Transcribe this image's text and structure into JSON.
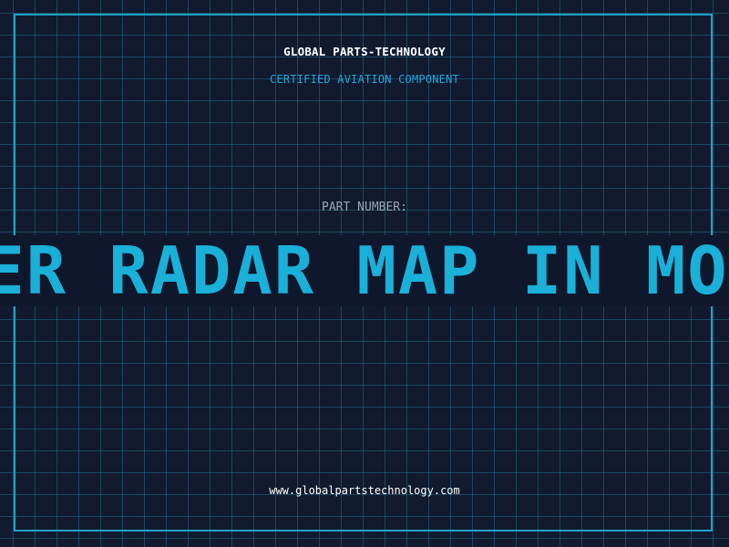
{
  "header": {
    "company": "GLOBAL PARTS-TECHNOLOGY",
    "subtitle": "CERTIFIED AVIATION COMPONENT"
  },
  "part": {
    "label": "PART NUMBER:",
    "scrolling_text": "HER RADAR MAP IN MO"
  },
  "footer": {
    "url": "www.globalpartstechnology.com"
  },
  "colors": {
    "background": "#111a2e",
    "grid": "#1f6e8c",
    "frame": "#1fa2c4",
    "accent": "#1ab0d8"
  }
}
